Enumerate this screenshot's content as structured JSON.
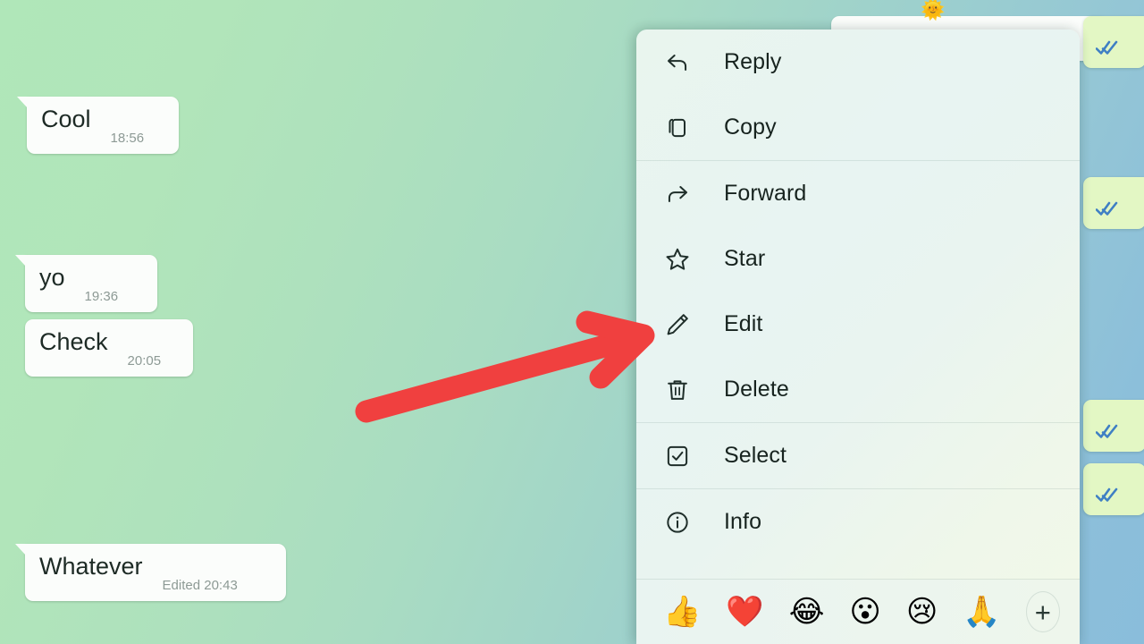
{
  "app": {
    "name": "whatsapp-message-context-menu",
    "background_colors": {
      "top_left": "#b0e7b9",
      "bottom_right": "#8abddb"
    }
  },
  "chat": {
    "incoming_bubble_color": "#fbfdfb",
    "outgoing_bubble_color": "#e3f7c4",
    "incoming_messages": [
      {
        "text": "Cool",
        "meta": "18:56",
        "tail": true
      },
      {
        "text": "yo",
        "meta": "19:36",
        "tail": true
      },
      {
        "text": "Check",
        "meta": "20:05",
        "tail": false
      },
      {
        "text": "Whatever",
        "meta": "Edited 20:43",
        "tail": true
      }
    ],
    "outgoing_messages": [
      {
        "status": "read-double-check",
        "tail": true
      },
      {
        "status": "read-double-check",
        "tail": true
      },
      {
        "status": "read-double-check",
        "tail": true
      },
      {
        "status": "read-double-check",
        "tail": false
      }
    ],
    "read_tick_color": "#3f7fc4"
  },
  "context_menu": {
    "groups": [
      {
        "items": [
          {
            "label": "Reply",
            "icon": "reply-arrow-icon"
          },
          {
            "label": "Copy",
            "icon": "copy-icon"
          }
        ]
      },
      {
        "items": [
          {
            "label": "Forward",
            "icon": "forward-arrow-icon"
          },
          {
            "label": "Star",
            "icon": "star-icon"
          },
          {
            "label": "Edit",
            "icon": "pencil-icon"
          },
          {
            "label": "Delete",
            "icon": "trash-icon"
          }
        ]
      },
      {
        "items": [
          {
            "label": "Select",
            "icon": "checkbox-icon"
          }
        ]
      },
      {
        "items": [
          {
            "label": "Info",
            "icon": "info-circle-icon"
          }
        ]
      }
    ],
    "reactions": [
      {
        "emoji": "👍",
        "name": "thumbs-up"
      },
      {
        "emoji": "❤️",
        "name": "red-heart"
      },
      {
        "emoji": "😂",
        "name": "face-with-tears-of-joy"
      },
      {
        "emoji": "😮",
        "name": "face-with-open-mouth"
      },
      {
        "emoji": "😢",
        "name": "crying-face"
      },
      {
        "emoji": "🙏",
        "name": "folded-hands"
      }
    ],
    "add_reaction_label": "+"
  },
  "annotation": {
    "arrow_color": "#f0403f",
    "points_to": "Edit"
  }
}
